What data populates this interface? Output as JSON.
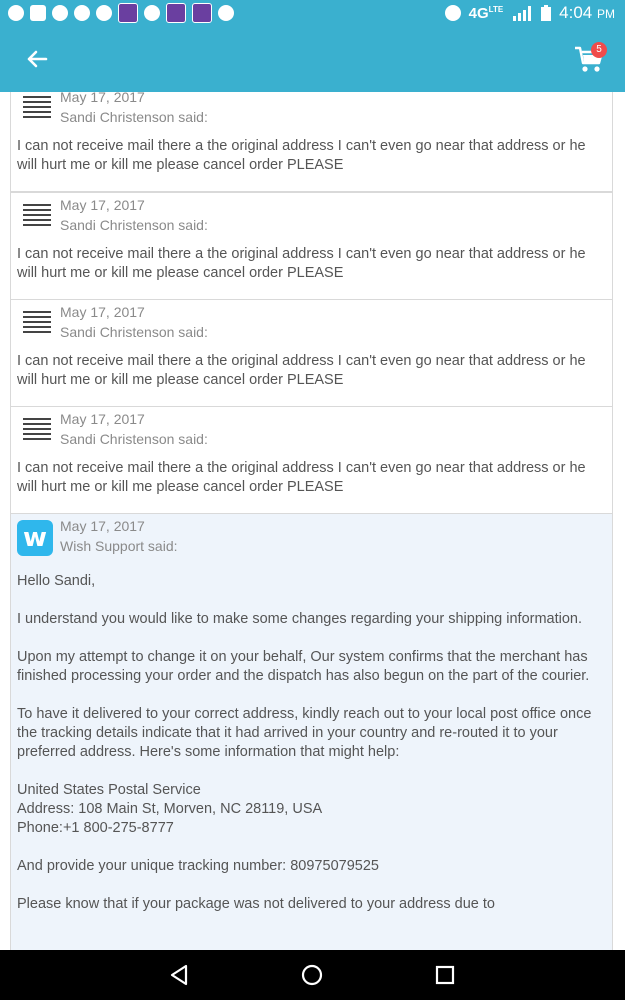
{
  "status_bar": {
    "time": "4:04",
    "ampm": "PM",
    "network": "4G",
    "network_sub": "LTE"
  },
  "app_bar": {
    "cart_count": "5"
  },
  "messages": [
    {
      "date": "May 17, 2017",
      "author_said": "Sandi Christenson said:",
      "text": "I can not receive mail there a the original address I can't even go near that address or he will hurt me or kill me please cancel order PLEASE"
    },
    {
      "date": "May 17, 2017",
      "author_said": "Sandi Christenson said:",
      "text": "I can not receive mail there a the original address I can't even go near that address or he will hurt me or kill me please cancel order PLEASE"
    },
    {
      "date": "May 17, 2017",
      "author_said": "Sandi Christenson said:",
      "text": "I can not receive mail there a the original address I can't even go near that address or he will hurt me or kill me please cancel order PLEASE"
    },
    {
      "date": "May 17, 2017",
      "author_said": "Sandi Christenson said:",
      "text": "I can not receive mail there a the original address I can't even go near that address or he will hurt me or kill me please cancel order PLEASE"
    }
  ],
  "support": {
    "date": "May 17, 2017",
    "author_said": "Wish Support said:",
    "logo_letter": "w",
    "greeting": "Hello Sandi,",
    "p1": "I understand you would like to make some changes regarding your shipping information.",
    "p2": "Upon my attempt to change it on your behalf, Our system confirms that the merchant has finished processing your order and the dispatch has also begun on the part of the courier.",
    "p3": "To have it delivered to your correct address, kindly reach out to your local post office once the tracking details indicate that it had arrived in your country and re-routed it to your preferred address. Here's some information that might help:",
    "postal_name": "United States Postal Service",
    "postal_address": "Address: 108 Main St, Morven, NC 28119, USA",
    "postal_phone": "Phone:+1 800-275-8777",
    "p4": "And provide your unique tracking number: 80975079525",
    "p5": "Please know that if your package was not delivered to your address due to"
  }
}
